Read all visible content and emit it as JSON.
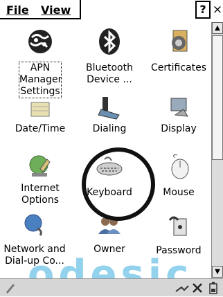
{
  "menubar": {
    "file": "File",
    "view": "View",
    "help": "?",
    "close": "×"
  },
  "items": [
    {
      "label": "APN Manager Settings",
      "lines": [
        "APN",
        "Manager",
        "Settings"
      ],
      "icon": "globe-icon"
    },
    {
      "label": "Bluetooth Device ...",
      "lines": [
        "Bluetooth",
        "Device ..."
      ],
      "icon": "bluetooth-icon"
    },
    {
      "label": "Certificates",
      "lines": [
        "Certificates"
      ],
      "icon": "certificate-icon"
    },
    {
      "label": "Date/Time",
      "lines": [
        "Date/Time"
      ],
      "icon": "calendar-icon"
    },
    {
      "label": "Dialing",
      "lines": [
        "Dialing"
      ],
      "icon": "phone-icon"
    },
    {
      "label": "Display",
      "lines": [
        "Display"
      ],
      "icon": "display-icon"
    },
    {
      "label": "Internet Options",
      "lines": [
        "Internet",
        "Options"
      ],
      "icon": "internet-icon"
    },
    {
      "label": "Keyboard",
      "lines": [
        "Keyboard"
      ],
      "icon": "keyboard-icon"
    },
    {
      "label": "Mouse",
      "lines": [
        "Mouse"
      ],
      "icon": "mouse-icon"
    },
    {
      "label": "Network and Dial-up Co...",
      "lines": [
        "Network and",
        "Dial-up Co..."
      ],
      "icon": "network-icon"
    },
    {
      "label": "Owner",
      "lines": [
        "Owner"
      ],
      "icon": "owner-icon"
    },
    {
      "label": "Password",
      "lines": [
        "Password"
      ],
      "icon": "password-icon"
    }
  ],
  "taskbar": {
    "start_icon": "pen-icon",
    "tray_icons": [
      "connection-icon",
      "disconnected-icon",
      "battery-icon"
    ]
  }
}
